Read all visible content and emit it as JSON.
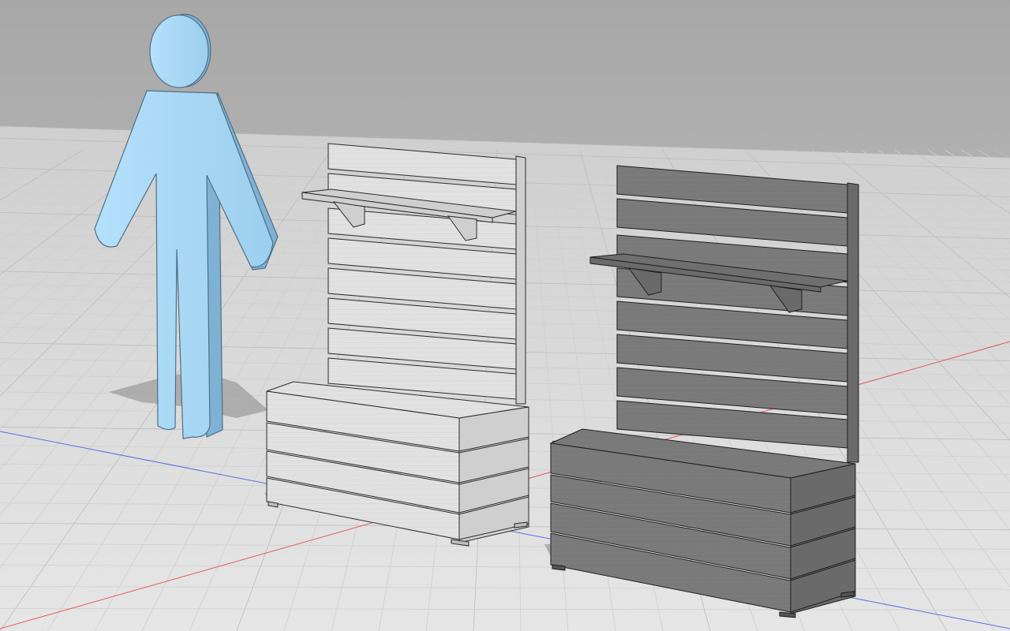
{
  "viewport": {
    "background_top": "#a9a9a9",
    "background_bottom": "#d4d4d4",
    "ground_color": "#dcdcdc",
    "grid_minor_color": "#cfcfcf",
    "grid_major_color": "#bcbcbc",
    "axis_x_color": "#e35a5a",
    "axis_y_color": "#5a6ee3",
    "shadows": true,
    "view": "perspective"
  },
  "objects": [
    {
      "name": "human-scale-figure",
      "color": "#a8d8f6",
      "edge_color": "#4f6f86",
      "shadow": true
    },
    {
      "name": "planter-bench-light",
      "slat_color": "#e3e3e3",
      "edge_color": "#2a2a2a",
      "soil_color": "#8aa882",
      "shelf_color": "#cfcfcf",
      "back_slats": 8,
      "planter_slats": 4,
      "shelf_brackets": 2
    },
    {
      "name": "planter-bench-dark",
      "slat_color": "#7c7c7c",
      "edge_color": "#1e1e1e",
      "soil_color": "#8aa882",
      "shelf_color": "#6f6f6f",
      "back_slats": 8,
      "planter_slats": 4,
      "shelf_brackets": 2
    }
  ]
}
